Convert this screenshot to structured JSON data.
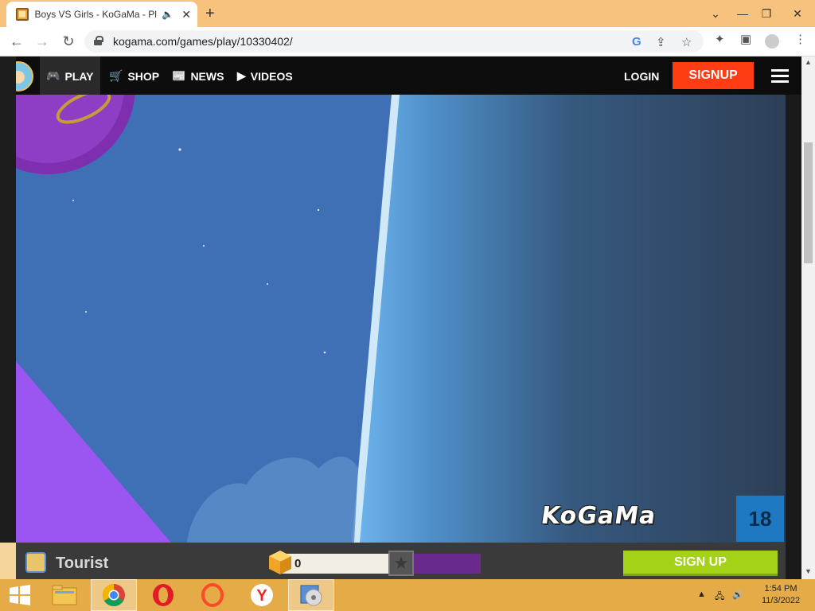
{
  "browser": {
    "tab_title": "Boys VS Girls - KoGaMa - Pla",
    "url": "kogama.com/games/play/10330402/"
  },
  "site_nav": {
    "play": "PLAY",
    "shop": "SHOP",
    "news": "NEWS",
    "videos": "VIDEOS",
    "login": "LOGIN",
    "signup": "SIGNUP"
  },
  "game": {
    "watermark": "KoGaMa",
    "level_badge": "18"
  },
  "game_bar": {
    "user_label": "Tourist",
    "gold_value": "0",
    "signup_label": "SIGN UP"
  },
  "taskbar": {
    "time": "1:54 PM",
    "date": "11/3/2022"
  },
  "colors": {
    "signup_red": "#ff3c14",
    "signup_green": "#a3d216",
    "level_purple": "#6a2a8c",
    "taskbar": "#e4ab47"
  }
}
